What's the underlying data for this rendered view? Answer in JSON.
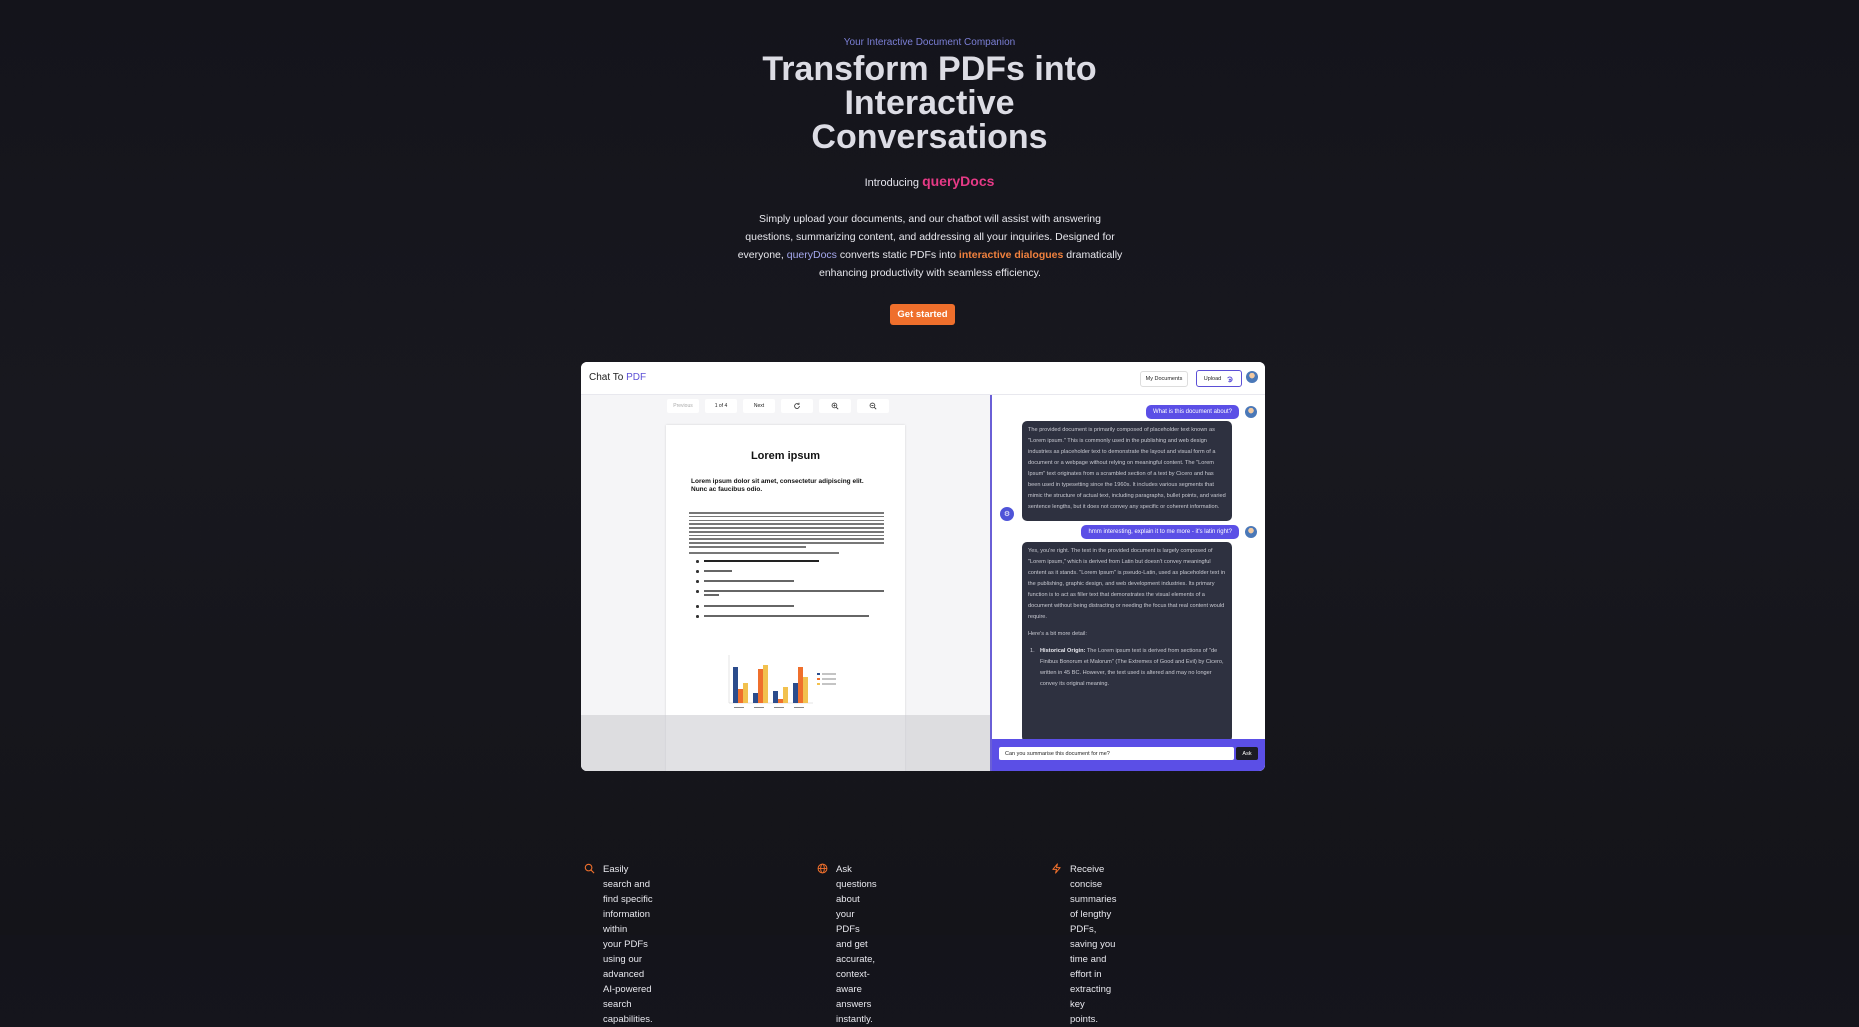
{
  "hero": {
    "tagline": "Your Interactive Document Companion",
    "headline_1": "Transform PDFs into",
    "headline_2": "Interactive",
    "headline_3": "Conversations",
    "intro_prefix": "Introducing",
    "brand": "queryDocs",
    "desc_1": "Simply upload your documents, and our chatbot will assist with answering questions, summarizing content, and addressing all your inquiries. Designed for everyone,",
    "desc_brand": "queryDocs",
    "desc_2": "converts static PDFs into",
    "desc_highlight": "interactive dialogues",
    "desc_3": "dramatically enhancing productivity with seamless efficiency.",
    "cta": "Get started"
  },
  "app": {
    "title": "Chat To",
    "title_accent": "PDF",
    "my_documents": "My Documents",
    "upload": "Upload",
    "pdf_toolbar": {
      "previous": "Previous",
      "page_indicator": "1 of 4",
      "next": "Next"
    },
    "document": {
      "title": "Lorem ipsum",
      "subtitle": "Lorem ipsum dolor sit amet, consectetur adipiscing elit. Nunc ac faucibus odio."
    },
    "chat": {
      "q1": "What is this document about?",
      "a1": "The provided document is primarily composed of placeholder text known as \"Lorem ipsum.\" This is commonly used in the publishing and web design industries as placeholder text to demonstrate the layout and visual form of a document or a webpage without relying on meaningful content. The \"Lorem Ipsum\" text originates from a scrambled section of a text by Cicero and has been used in typesetting since the 1960s. It includes various segments that mimic the structure of actual text, including paragraphs, bullet points, and varied sentence lengths, but it does not convey any specific or coherent information.",
      "q2": "hmm interesting, explain it to me more - it's latin right?",
      "a2_p1": "Yes, you're right. The text in the provided document is largely composed of \"Lorem ipsum,\" which is derived from Latin but doesn't convey meaningful content as it stands. \"Lorem Ipsum\" is pseudo-Latin, used as placeholder text in the publishing, graphic design, and web development industries. Its primary function is to act as filler text that demonstrates the visual elements of a document without being distracting or needing the focus that real content would require.",
      "a2_p2": "Here's a bit more detail:",
      "a2_item_label": "Historical Origin:",
      "a2_item_text": "The Lorem ipsum text is derived from sections of \"de Finibus Bonorum et Malorum\" (The Extremes of Good and Evil) by Cicero, written in 45 BC. However, the text used is altered and may no longer convey its original meaning.",
      "input_value": "Can you summarise this document for me?",
      "ask": "Ask"
    }
  },
  "features": [
    {
      "icon": "search-icon",
      "text_1": "Easily search and find specific information within",
      "text_2": "your PDFs using our advanced AI-powered",
      "text_3": "search capabilities."
    },
    {
      "icon": "globe-icon",
      "text_1": "Ask questions about your PDFs and get accurate,",
      "text_2": "context-aware answers instantly.",
      "text_3": ""
    },
    {
      "icon": "zap-icon",
      "text_1": "Receive concise summaries of lengthy PDFs,",
      "text_2": "saving you time and effort in extracting key",
      "text_3": "points."
    }
  ],
  "colors": {
    "accent_orange": "#ef6f2c",
    "brand_pink": "#e63a86",
    "accent_purple": "#5b4fe6"
  }
}
